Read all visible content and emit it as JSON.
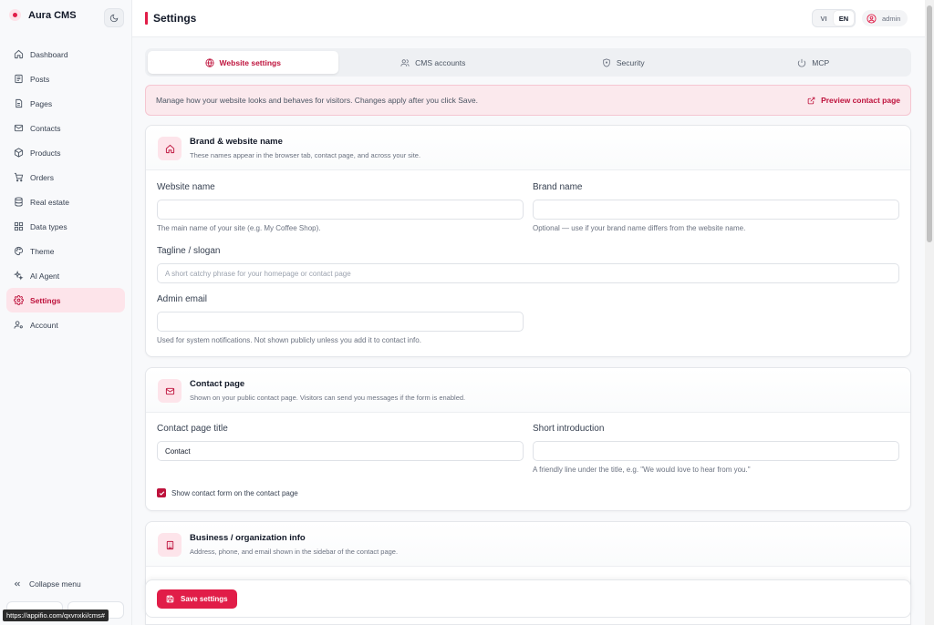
{
  "app": {
    "name": "Aura CMS"
  },
  "sidebar": {
    "items": [
      {
        "label": "Dashboard",
        "icon": "home-icon"
      },
      {
        "label": "Posts",
        "icon": "document-icon"
      },
      {
        "label": "Pages",
        "icon": "page-icon"
      },
      {
        "label": "Contacts",
        "icon": "mail-icon"
      },
      {
        "label": "Products",
        "icon": "box-icon"
      },
      {
        "label": "Orders",
        "icon": "cart-icon"
      },
      {
        "label": "Real estate",
        "icon": "database-icon"
      },
      {
        "label": "Data types",
        "icon": "grid-icon"
      },
      {
        "label": "Theme",
        "icon": "palette-icon"
      },
      {
        "label": "AI Agent",
        "icon": "sparkle-icon"
      },
      {
        "label": "Settings",
        "icon": "gear-icon",
        "active": true
      },
      {
        "label": "Account",
        "icon": "user-gear-icon"
      }
    ],
    "collapse_label": "Collapse menu"
  },
  "header": {
    "title": "Settings",
    "lang_vi": "VI",
    "lang_en": "EN",
    "user": "admin"
  },
  "tabs": [
    {
      "label": "Website settings",
      "icon": "globe-icon",
      "active": true
    },
    {
      "label": "CMS accounts",
      "icon": "users-icon"
    },
    {
      "label": "Security",
      "icon": "shield-icon"
    },
    {
      "label": "MCP",
      "icon": "power-icon"
    }
  ],
  "notice": {
    "text": "Manage how your website looks and behaves for visitors. Changes apply after you click Save.",
    "preview_label": "Preview contact page"
  },
  "brand_card": {
    "title": "Brand & website name",
    "desc": "These names appear in the browser tab, contact page, and across your site.",
    "website_name_label": "Website name",
    "website_name_value": "",
    "website_name_hint": "The main name of your site (e.g. My Coffee Shop).",
    "brand_name_label": "Brand name",
    "brand_name_value": "",
    "brand_name_hint": "Optional — use if your brand name differs from the website name.",
    "tagline_label": "Tagline / slogan",
    "tagline_placeholder": "A short catchy phrase for your homepage or contact page",
    "admin_email_label": "Admin email",
    "admin_email_value": "",
    "admin_email_hint": "Used for system notifications. Not shown publicly unless you add it to contact info."
  },
  "contact_card": {
    "title": "Contact page",
    "desc": "Shown on your public contact page. Visitors can send you messages if the form is enabled.",
    "title_label": "Contact page title",
    "title_value": "Contact",
    "intro_label": "Short introduction",
    "intro_value": "",
    "intro_hint": "A friendly line under the title, e.g. \"We would love to hear from you.\"",
    "show_form_label": "Show contact form on the contact page",
    "show_form_checked": true
  },
  "business_card": {
    "title": "Business / organization info",
    "desc": "Address, phone, and email shown in the sidebar of the contact page."
  },
  "save": {
    "label": "Save settings"
  },
  "status_url": "https://appifio.com/qxvnxki/cms#",
  "colors": {
    "accent": "#e11d48",
    "accent_dark": "#be123c",
    "accent_soft": "#fde4ea"
  }
}
